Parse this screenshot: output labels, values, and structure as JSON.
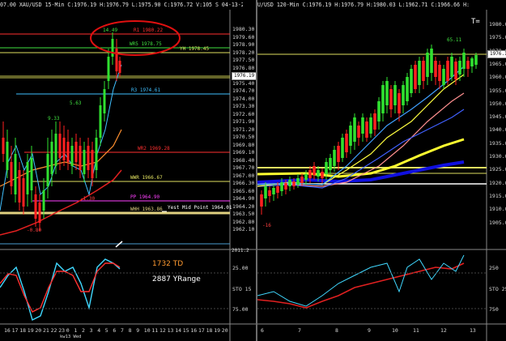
{
  "left_chart": {
    "header": "07.00  XAU/USD 15-Min  C:1976.19  H:1976.79  L:1975.90  C:1976.72  V:105  S  04-13-22 13:20",
    "y_ticks": [
      "1980.30",
      "1979.60",
      "1978.90",
      "1978.20",
      "1977.50",
      "1976.80",
      "1976.19",
      "1975.40",
      "1974.70",
      "1974.00",
      "1973.30",
      "1972.60",
      "1971.90",
      "1971.20",
      "1970.50",
      "1969.80",
      "1969.10",
      "1968.40",
      "1967.70",
      "1967.00",
      "1966.30",
      "1965.60",
      "1964.90",
      "1964.20",
      "1963.50",
      "1962.80",
      "1962.10"
    ],
    "current_price": "1976.19",
    "levels": [
      {
        "label": "R1 1980.22",
        "color": "#ff3030"
      },
      {
        "label": "WR5 1978.75",
        "color": "#40e040"
      },
      {
        "label": "YH 1978.45",
        "color": "#e0e060"
      },
      {
        "label": "R3 1974.61",
        "color": "#40c0ff"
      },
      {
        "label": "WR2 1969.28",
        "color": "#ff3030"
      },
      {
        "label": "WWR 1966.67",
        "color": "#e0e060"
      },
      {
        "label": "PP 1964.90",
        "color": "#ff40ff"
      },
      {
        "label": "WHH 1963.86",
        "color": "#e0d080"
      },
      {
        "label": "Yest Mid Point 1964.01",
        "color": "#ffffff"
      }
    ],
    "annotations": {
      "top_count": "14.49",
      "mid_count": "5.63",
      "left_count": "9.33",
      "low_count": "-0.80",
      "pp_count": "-1.30"
    },
    "oscillator": {
      "td_text": "1732 TD",
      "yrange_text": "2887 YRange",
      "sto_label": "STO",
      "sto_tick_top": "25.00",
      "sto_tick_mid": "15",
      "sto_tick_bot": "75.00",
      "scale_top": "2011.2"
    },
    "x_ticks": [
      "16",
      "17",
      "18",
      "19",
      "20",
      "21",
      "22",
      "23",
      "0",
      "1",
      "2",
      "3",
      "4",
      "5",
      "6",
      "7",
      "8",
      "9",
      "10",
      "11",
      "12",
      "13",
      "14",
      "15",
      "16",
      "17",
      "18",
      "19",
      "20"
    ],
    "x_subtitle": "kw13 Wed"
  },
  "right_chart": {
    "header": "U/USD  120-Min  C:1976.19  H:1976.79  H:1980.03  L:1962.71  C:1966.66  H:1976.19  L:1958.80  04-13-22 1:58.20",
    "top_right_status": "T=",
    "y_ticks": [
      "1980.00",
      "1975.00",
      "1970.00",
      "1965.00",
      "1960.00",
      "1955.00",
      "1950.00",
      "1945.00",
      "1940.00",
      "1935.00",
      "1930.00",
      "1925.00",
      "1920.00",
      "1915.00",
      "1910.00",
      "1905.00"
    ],
    "current_price": "1976.19",
    "annotations": {
      "top_count": "65.11",
      "bottom_count": "-16"
    },
    "oscillator": {
      "sto_label": "STO",
      "sto_tick_top": "250",
      "sto_tick_mid": "25",
      "sto_tick_bot": "750"
    },
    "x_ticks": [
      "6",
      "7",
      "8",
      "9",
      "10",
      "11",
      "12",
      "13"
    ]
  },
  "colors": {
    "bull": "#30e030",
    "bear": "#ff2020",
    "accent_circle": "#e01010"
  }
}
